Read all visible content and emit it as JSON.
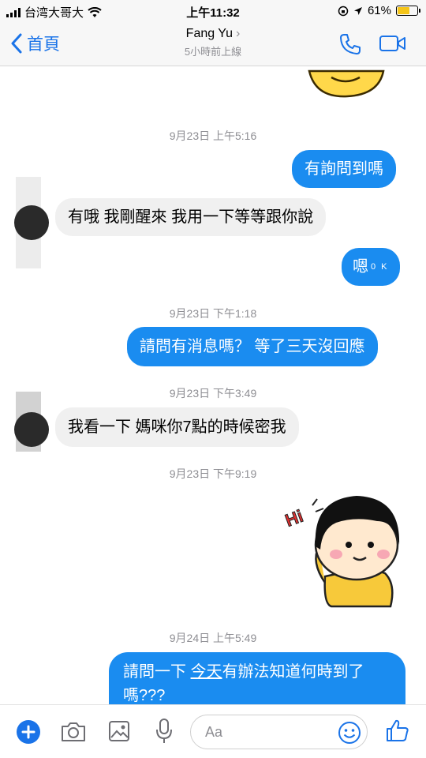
{
  "status_bar": {
    "carrier": "台湾大哥大",
    "time": "上午11:32",
    "battery": "61%",
    "battery_level": 0.61
  },
  "header": {
    "back_label": "首頁",
    "contact_name": "Fang Yu",
    "last_active": "5小時前上線"
  },
  "messages": {
    "ts1": "9月23日 上午5:16",
    "m1": "有詢問到嗎",
    "m2": "有哦 我剛醒來 我用一下等等跟你說",
    "m3": "嗯",
    "m3_sup": "0 K",
    "ts2": "9月23日 下午1:18",
    "m4": "請問有消息嗎？ 等了三天沒回應",
    "ts3": "9月23日 下午3:49",
    "m5": "我看一下 媽咪你7點的時候密我",
    "ts4": "9月23日 下午9:19",
    "sticker_text": "Hi",
    "ts5": "9月24日 上午5:49",
    "m6_a": "請問一下 ",
    "m6_b": "今天",
    "m6_c": "有辦法知道何時到了",
    "m6_d": "嗎???"
  },
  "composer": {
    "placeholder": "Aa"
  },
  "colors": {
    "accent": "#1a8cf0",
    "incoming_bubble": "#f0f0f0",
    "timestamp": "#8e8e93"
  },
  "icons": [
    "signal-icon",
    "wifi-icon",
    "lock-rotation-icon",
    "location-icon",
    "battery-icon",
    "back-chevron-icon",
    "phone-icon",
    "video-icon",
    "plus-icon",
    "camera-icon",
    "image-icon",
    "microphone-icon",
    "emoji-icon",
    "thumbs-up-icon"
  ]
}
